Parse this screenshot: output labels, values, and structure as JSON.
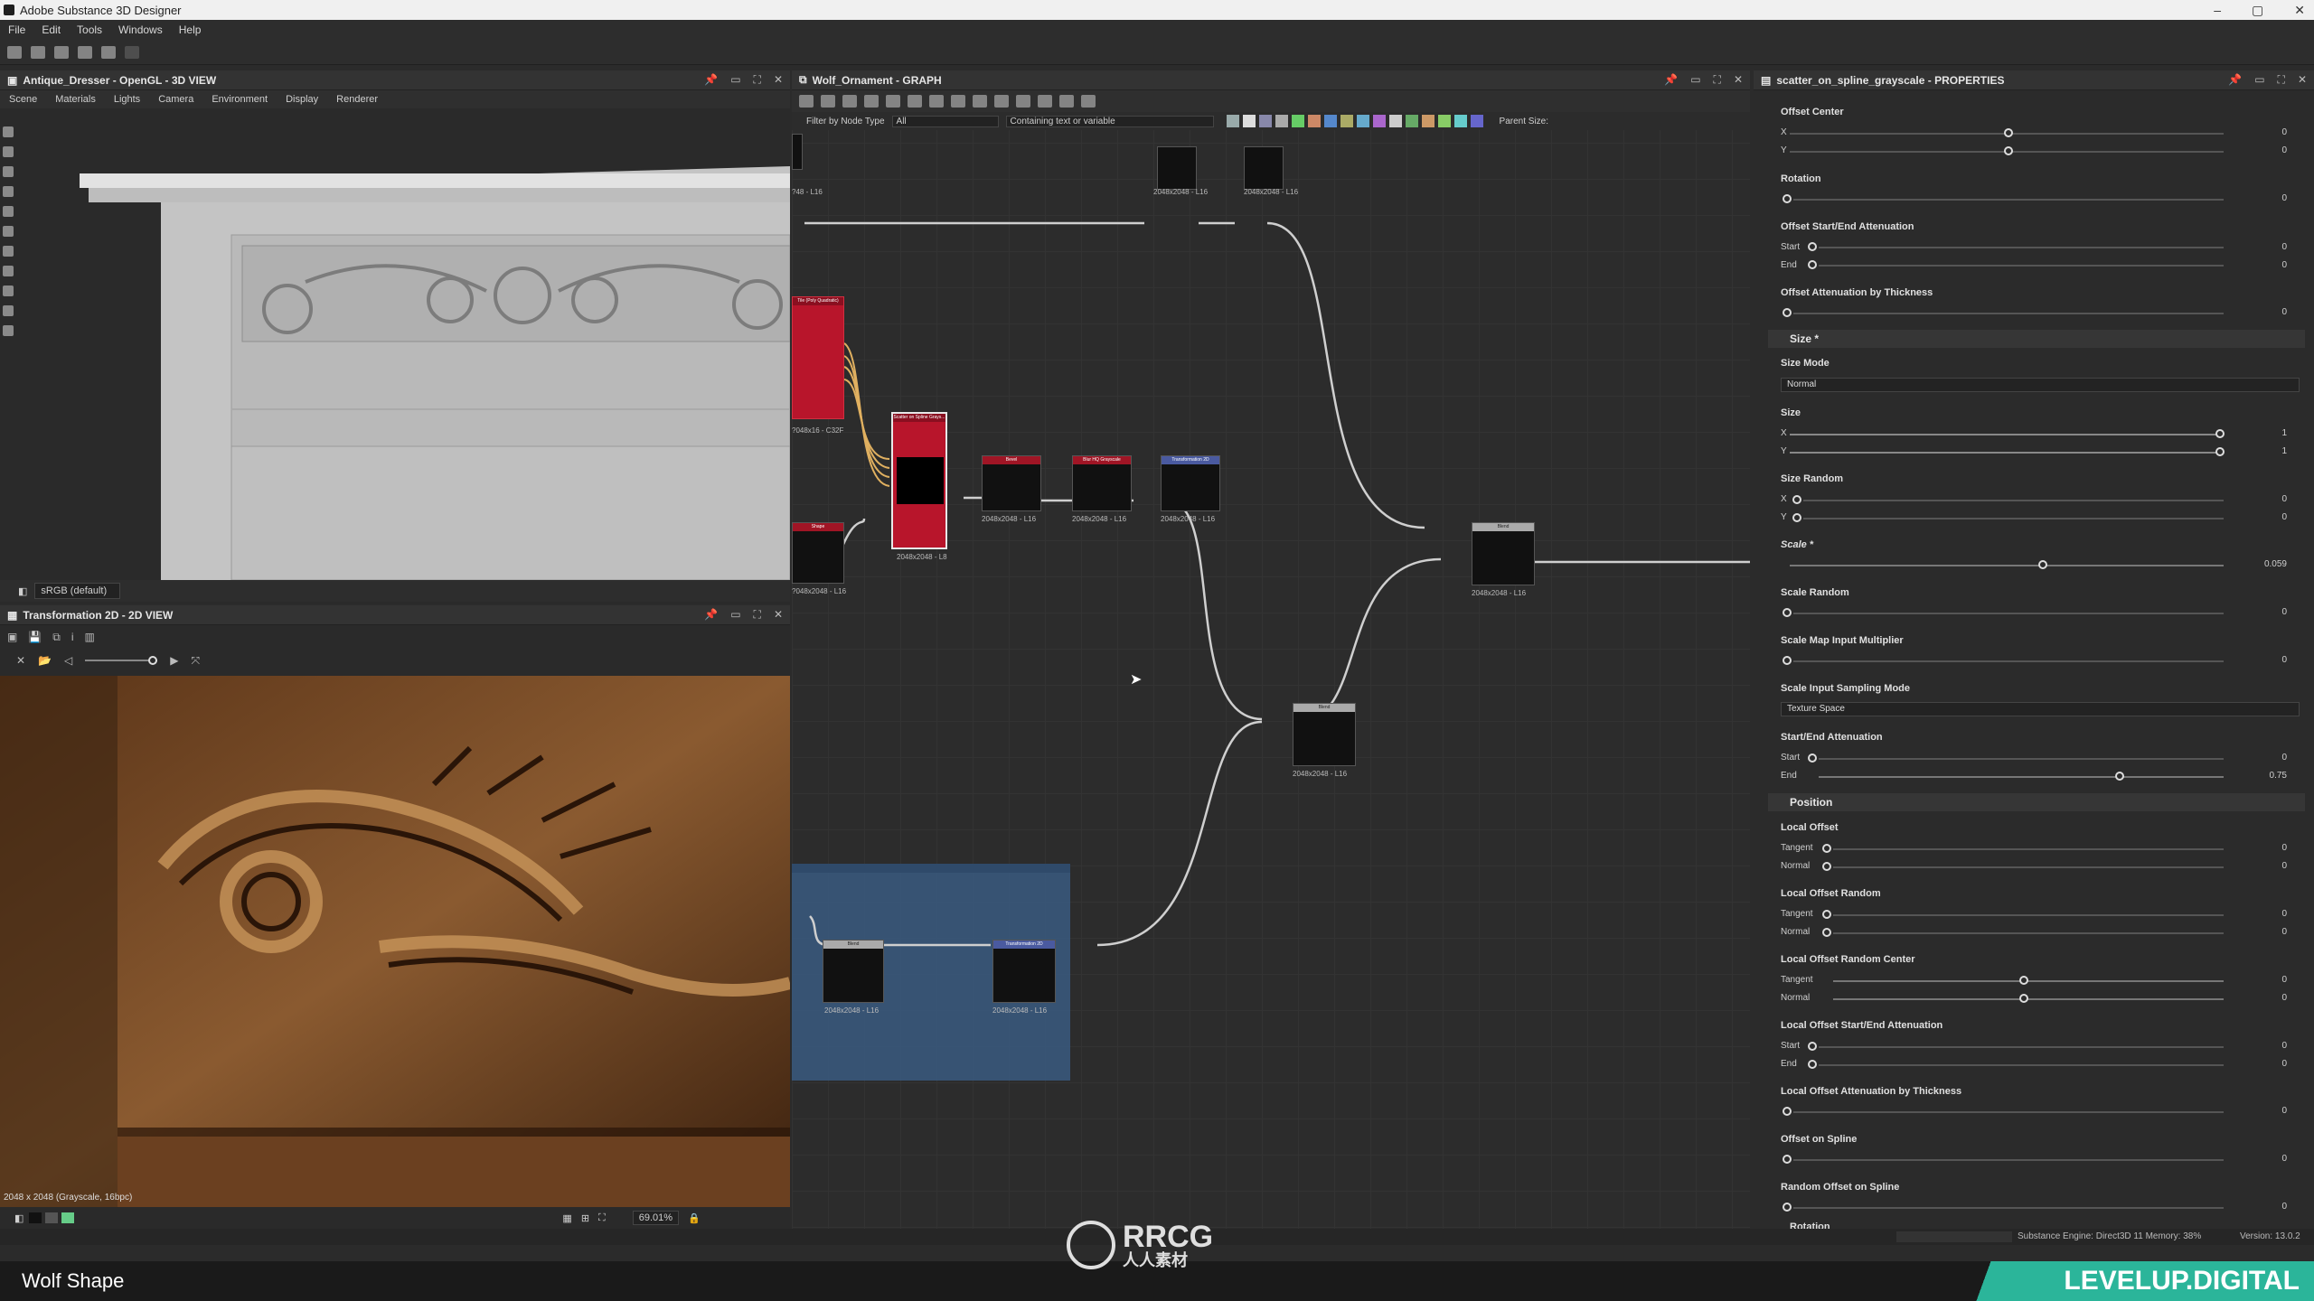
{
  "window": {
    "title": "Adobe Substance 3D Designer"
  },
  "menu": [
    "File",
    "Edit",
    "Tools",
    "Windows",
    "Help"
  ],
  "view3d": {
    "title": "Antique_Dresser - OpenGL - 3D VIEW",
    "tabs": [
      "Scene",
      "Materials",
      "Lights",
      "Camera",
      "Environment",
      "Display",
      "Renderer"
    ],
    "colorspace": "sRGB (default)"
  },
  "view2d": {
    "title": "Transformation 2D - 2D VIEW",
    "info": "2048 x 2048 (Grayscale, 16bpc)",
    "zoom": "69.01%"
  },
  "graph": {
    "title": "Wolf_Ornament - GRAPH",
    "filter_label": "Filter by Node Type",
    "filter_value": "All",
    "containing_placeholder": "Containing text or variable",
    "parent_size": "Parent Size:",
    "nodes": {
      "n_top1": "2048x2048 - L16",
      "n_top2": "2048x2048 - L16",
      "n_top0": "?48 - L16",
      "n_poly": "Tile (Poly Quadratic)",
      "n_poly_res": "?048x16 - C32F",
      "n_scatter": "Scatter on Spline Grays...",
      "n_scatter_res": "2048x2048 - L8",
      "n_bevel": "Bevel",
      "n_bevel_res": "2048x2048 - L16",
      "n_blur": "Blur HQ Grayscale",
      "n_blur_res": "2048x2048 - L16",
      "n_trans": "Transformation 2D",
      "n_trans_res": "2048x2048 - L16",
      "n_shape": "Shape",
      "n_shape_res": "?048x2048 - L16",
      "n_blend1": "Blend",
      "n_blend1_res": "2048x2048 - L16",
      "n_blend2": "Blend",
      "n_blend2_res": "2048x2048 - L16",
      "n_blend3": "Blend",
      "n_blend3_res": "2048x2048 - L16",
      "n_trans2": "Transformation 2D",
      "n_trans2_res": "2048x2048 - L16"
    }
  },
  "props": {
    "title": "scatter_on_spline_grayscale - PROPERTIES",
    "rows": {
      "offset_center": "Offset Center",
      "x": "X",
      "y": "Y",
      "zero": "0",
      "one": "1",
      "rotation": "Rotation",
      "offset_se_att": "Offset Start/End Attenuation",
      "start": "Start",
      "end": "End",
      "offset_att_thick": "Offset Attenuation by Thickness",
      "size_section": "Size *",
      "size_mode": "Size Mode",
      "size_mode_value": "Normal",
      "size": "Size",
      "size_random": "Size Random",
      "scale": "Scale *",
      "scale_value": "0.059",
      "scale_random": "Scale Random",
      "scale_map_mult": "Scale Map Input Multiplier",
      "scale_sampling": "Scale Input Sampling Mode",
      "scale_sampling_value": "Texture Space",
      "se_att": "Start/End Attenuation",
      "end_value": "0.75",
      "position_section": "Position",
      "local_offset": "Local Offset",
      "tangent": "Tangent",
      "normal": "Normal",
      "local_offset_random": "Local Offset Random",
      "local_offset_random_center": "Local Offset Random Center",
      "local_offset_se_att": "Local Offset Start/End Attenuation",
      "local_offset_att_thick": "Local Offset Attenuation by Thickness",
      "offset_on_spline": "Offset on Spline",
      "random_offset_on_spline": "Random Offset on Spline",
      "rotation_section": "Rotation"
    }
  },
  "status": {
    "engine": "Substance Engine: Direct3D 11  Memory: 38%",
    "version": "Version: 13.0.2"
  },
  "caption": "Wolf Shape",
  "brand": "LEVELUP.DIGITAL",
  "watermark": "RRCG",
  "watermark_sub": "人人素材"
}
